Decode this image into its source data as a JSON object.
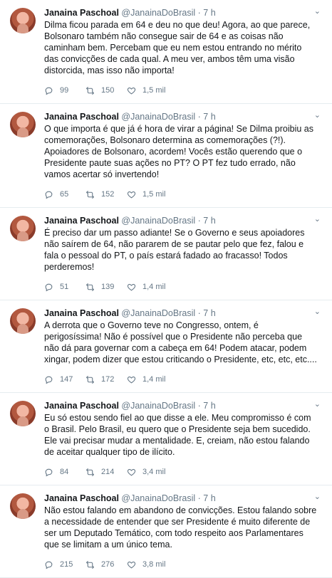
{
  "tweets": [
    {
      "name": "Janaina Paschoal",
      "handle": "@JanainaDoBrasil",
      "dot": "·",
      "time": "7 h",
      "text": "Dilma ficou parada em 64 e deu no que deu! Agora, ao que parece, Bolsonaro também não consegue sair de 64 e as coisas não caminham bem. Percebam que eu nem estou entrando no mérito das convicções de cada qual. A meu ver, ambos têm uma visão distorcida, mas isso não importa!",
      "replies": "99",
      "retweets": "150",
      "likes": "1,5 mil"
    },
    {
      "name": "Janaina Paschoal",
      "handle": "@JanainaDoBrasil",
      "dot": "·",
      "time": "7 h",
      "text": "O que importa é que já é hora de virar a página! Se Dilma proibiu as comemorações, Bolsonaro determina as comemorações (?!). Apoiadores de Bolsonaro, acordem! Vocês estão querendo que o Presidente paute suas ações no PT? O PT fez tudo errado, não vamos acertar só invertendo!",
      "replies": "65",
      "retweets": "152",
      "likes": "1,5 mil"
    },
    {
      "name": "Janaina Paschoal",
      "handle": "@JanainaDoBrasil",
      "dot": "·",
      "time": "7 h",
      "text": "É preciso dar um passo adiante! Se o Governo e seus apoiadores não saírem de 64, não pararem de se pautar pelo que fez, falou e fala o pessoal do PT, o país estará fadado ao fracasso! Todos perderemos!",
      "replies": "51",
      "retweets": "139",
      "likes": "1,4 mil"
    },
    {
      "name": "Janaina Paschoal",
      "handle": "@JanainaDoBrasil",
      "dot": "·",
      "time": "7 h",
      "text": "A derrota que o Governo teve no Congresso, ontem, é perigosíssima! Não é possível que o Presidente não perceba que não dá para governar com a cabeça em 64! Podem atacar, podem xingar, podem dizer que estou criticando o Presidente, etc, etc, etc....",
      "replies": "147",
      "retweets": "172",
      "likes": "1,4 mil"
    },
    {
      "name": "Janaina Paschoal",
      "handle": "@JanainaDoBrasil",
      "dot": "·",
      "time": "7 h",
      "text": "Eu só estou sendo fiel ao que disse a ele. Meu compromisso é com o Brasil. Pelo Brasil, eu quero que o Presidente seja bem sucedido. Ele vai precisar mudar a mentalidade. E, creiam, não estou falando de aceitar qualquer tipo de ilícito.",
      "replies": "84",
      "retweets": "214",
      "likes": "3,4 mil"
    },
    {
      "name": "Janaina Paschoal",
      "handle": "@JanainaDoBrasil",
      "dot": "·",
      "time": "7 h",
      "text": "Não estou falando em abandono de convicções. Estou falando sobre a necessidade de entender que ser Presidente é muito diferente de ser um Deputado Temático, com todo respeito aos Parlamentares que se limitam a um único tema.",
      "replies": "215",
      "retweets": "276",
      "likes": "3,8 mil"
    }
  ],
  "icons": {
    "reply": "reply-icon",
    "retweet": "retweet-icon",
    "like": "heart-icon",
    "more": "chevron-down-icon"
  },
  "colors": {
    "text": "#14171a",
    "secondary": "#657786",
    "divider": "#e6ecf0"
  }
}
